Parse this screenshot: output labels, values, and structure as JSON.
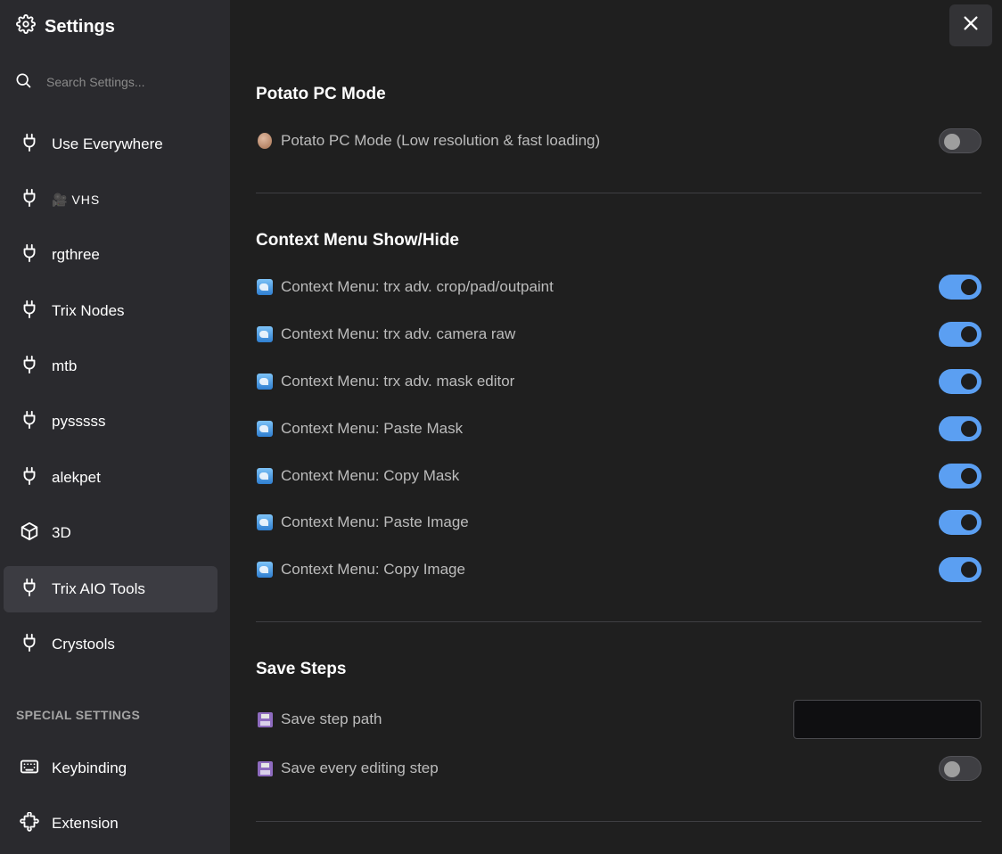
{
  "sidebar": {
    "title": "Settings",
    "search_placeholder": "Search Settings...",
    "items": [
      {
        "label": "Use Everywhere",
        "icon": "plug-icon"
      },
      {
        "label": "VHS",
        "icon": "plug-icon",
        "prefix": "🎥"
      },
      {
        "label": "rgthree",
        "icon": "plug-icon"
      },
      {
        "label": "Trix Nodes",
        "icon": "plug-icon"
      },
      {
        "label": "mtb",
        "icon": "plug-icon"
      },
      {
        "label": "pysssss",
        "icon": "plug-icon"
      },
      {
        "label": "alekpet",
        "icon": "plug-icon"
      },
      {
        "label": "3D",
        "icon": "cube-icon"
      },
      {
        "label": "Trix AIO Tools",
        "icon": "plug-icon",
        "active": true
      },
      {
        "label": "Crystools",
        "icon": "plug-icon"
      }
    ],
    "special_label": "SPECIAL SETTINGS",
    "special_items": [
      {
        "label": "Keybinding",
        "icon": "keyboard-icon"
      },
      {
        "label": "Extension",
        "icon": "puzzle-icon"
      }
    ]
  },
  "main": {
    "sections": [
      {
        "title": "Potato PC Mode",
        "settings": [
          {
            "label": "Potato PC Mode (Low resolution & fast loading)",
            "icon": "potato-icon",
            "type": "toggle",
            "value": false
          }
        ]
      },
      {
        "title": "Context Menu Show/Hide",
        "settings": [
          {
            "label": "Context Menu: trx adv. crop/pad/outpaint",
            "icon": "wave-icon",
            "type": "toggle",
            "value": true
          },
          {
            "label": "Context Menu: trx adv. camera raw",
            "icon": "wave-icon",
            "type": "toggle",
            "value": true
          },
          {
            "label": "Context Menu: trx adv. mask editor",
            "icon": "wave-icon",
            "type": "toggle",
            "value": true
          },
          {
            "label": "Context Menu: Paste Mask",
            "icon": "wave-icon",
            "type": "toggle",
            "value": true
          },
          {
            "label": "Context Menu: Copy Mask",
            "icon": "wave-icon",
            "type": "toggle",
            "value": true
          },
          {
            "label": "Context Menu: Paste Image",
            "icon": "wave-icon",
            "type": "toggle",
            "value": true
          },
          {
            "label": "Context Menu: Copy Image",
            "icon": "wave-icon",
            "type": "toggle",
            "value": true
          }
        ]
      },
      {
        "title": "Save Steps",
        "settings": [
          {
            "label": "Save step path",
            "icon": "floppy-disk-icon",
            "type": "text",
            "value": ""
          },
          {
            "label": "Save every editing step",
            "icon": "floppy-disk-icon",
            "type": "toggle",
            "value": false
          }
        ]
      }
    ]
  },
  "colors": {
    "sidebar_bg": "#2a2a2e",
    "main_bg": "#1f1f1f",
    "active_item_bg": "#3c3c42",
    "toggle_on": "#5b9ff2",
    "toggle_off": "#3f3f43"
  }
}
